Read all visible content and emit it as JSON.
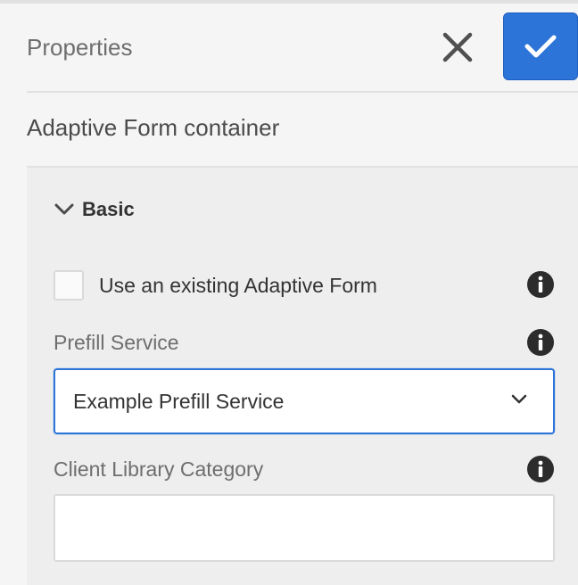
{
  "header": {
    "title": "Properties"
  },
  "subtitle": "Adaptive Form container",
  "accordion": {
    "label": "Basic"
  },
  "fields": {
    "use_existing": {
      "label": "Use an existing Adaptive Form",
      "checked": false
    },
    "prefill_service": {
      "label": "Prefill Service",
      "value": "Example Prefill Service"
    },
    "client_library_category": {
      "label": "Client Library Category",
      "value": ""
    }
  },
  "colors": {
    "accent": "#2d74d9",
    "panel_bg": "#eeeeee",
    "page_bg": "#f5f5f5"
  }
}
